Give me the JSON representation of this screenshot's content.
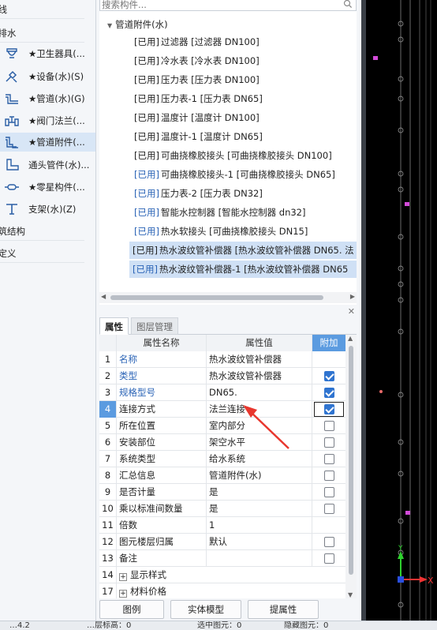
{
  "left_panel": {
    "sections": {
      "top": "轴线",
      "drainage": "给排水",
      "structure": "建筑结构",
      "custom": "自定义"
    },
    "items": [
      {
        "label": "★卫生器具(...",
        "icon": "sanitary-fixture-icon"
      },
      {
        "label": "★设备(水)(S)",
        "icon": "equipment-icon"
      },
      {
        "label": "★管道(水)(G)",
        "icon": "pipe-icon"
      },
      {
        "label": "★阀门法兰(...",
        "icon": "valve-flange-icon"
      },
      {
        "label": "★管道附件(...",
        "icon": "pipe-accessory-icon",
        "active": true
      },
      {
        "label": "通头管件(水)...",
        "icon": "pipe-fitting-icon"
      },
      {
        "label": "★零星构件(...",
        "icon": "misc-component-icon"
      },
      {
        "label": "支架(水)(Z)",
        "icon": "bracket-icon"
      }
    ]
  },
  "search": {
    "placeholder": "搜索构件..."
  },
  "tree": {
    "root": "管道附件(水)",
    "items": [
      {
        "tag": "[已用]",
        "text": "过滤器 [过滤器 DN100]",
        "blue": false
      },
      {
        "tag": "[已用]",
        "text": "冷水表 [冷水表 DN100]",
        "blue": false
      },
      {
        "tag": "[已用]",
        "text": "压力表 [压力表 DN100]",
        "blue": false
      },
      {
        "tag": "[已用]",
        "text": "压力表-1 [压力表 DN65]",
        "blue": false
      },
      {
        "tag": "[已用]",
        "text": "温度计 [温度计 DN100]",
        "blue": false
      },
      {
        "tag": "[已用]",
        "text": "温度计-1 [温度计 DN65]",
        "blue": false
      },
      {
        "tag": "[已用]",
        "text": "可曲挠橡胶接头 [可曲挠橡胶接头 DN100]",
        "blue": false
      },
      {
        "tag": "[已用]",
        "text": "可曲挠橡胶接头-1 [可曲挠橡胶接头 DN65]",
        "blue": true
      },
      {
        "tag": "[已用]",
        "text": "压力表-2 [压力表 DN32]",
        "blue": true
      },
      {
        "tag": "[已用]",
        "text": "智能水控制器 [智能水控制器 dn32]",
        "blue": true
      },
      {
        "tag": "[已用]",
        "text": "热水软接头 [可曲挠橡胶接头 DN15]",
        "blue": true
      },
      {
        "tag": "[已用]",
        "text": "热水波纹管补偿器 [热水波纹管补偿器 DN65. 法",
        "blue": false,
        "selected": true
      },
      {
        "tag": "[已用]",
        "text": "热水波纹管补偿器-1 [热水波纹管补偿器 DN65",
        "blue": true,
        "selected": true
      }
    ]
  },
  "tabs": [
    {
      "label": "属性",
      "active": true
    },
    {
      "label": "图层管理",
      "active": false
    }
  ],
  "grid": {
    "headers": {
      "num": "",
      "name": "属性名称",
      "value": "属性值",
      "add": "附加"
    },
    "rows": [
      {
        "num": "1",
        "name": "名称",
        "value": "热水波纹管补偿器",
        "blue": true,
        "check": "none"
      },
      {
        "num": "2",
        "name": "类型",
        "value": "热水波纹管补偿器",
        "blue": true,
        "check": "checked"
      },
      {
        "num": "3",
        "name": "规格型号",
        "value": "DN65.",
        "blue": true,
        "check": "checked"
      },
      {
        "num": "4",
        "name": "连接方式",
        "value": "法兰连接",
        "blue": false,
        "check": "checked",
        "highlight": true
      },
      {
        "num": "5",
        "name": "所在位置",
        "value": "室内部分",
        "blue": false,
        "check": "unchecked"
      },
      {
        "num": "6",
        "name": "安装部位",
        "value": "架空水平",
        "blue": false,
        "check": "unchecked"
      },
      {
        "num": "7",
        "name": "系统类型",
        "value": "给水系统",
        "blue": false,
        "check": "unchecked"
      },
      {
        "num": "8",
        "name": "汇总信息",
        "value": "管道附件(水)",
        "blue": false,
        "check": "unchecked"
      },
      {
        "num": "9",
        "name": "是否计量",
        "value": "是",
        "blue": false,
        "check": "unchecked"
      },
      {
        "num": "10",
        "name": "乘以标准间数量",
        "value": "是",
        "blue": false,
        "check": "unchecked"
      },
      {
        "num": "11",
        "name": "倍数",
        "value": "1",
        "blue": false,
        "check": "none"
      },
      {
        "num": "12",
        "name": "图元楼层归属",
        "value": "默认",
        "blue": false,
        "check": "unchecked"
      },
      {
        "num": "13",
        "name": "备注",
        "value": "",
        "blue": false,
        "check": "unchecked"
      },
      {
        "num": "14",
        "name": "显示样式",
        "value": "",
        "blue": false,
        "check": "none",
        "expander": true
      },
      {
        "num": "17",
        "name": "材料价格",
        "value": "",
        "blue": false,
        "check": "none",
        "expander": true
      }
    ]
  },
  "buttons": {
    "legend": "图例",
    "solid_model": "实体模型",
    "extract": "提属性"
  },
  "canvas": {
    "axis_x": "X",
    "axis_y": "Y"
  },
  "statusbar": {
    "s1": "…4.2",
    "s2": "…层标高：0",
    "s3": "选中图元：0",
    "s4": "隐藏图元：0"
  },
  "colors": {
    "accent": "#5b9be0",
    "selected_row": "#cfe0f5",
    "link_blue": "#2a63b6",
    "annotation": "#e8372e"
  }
}
